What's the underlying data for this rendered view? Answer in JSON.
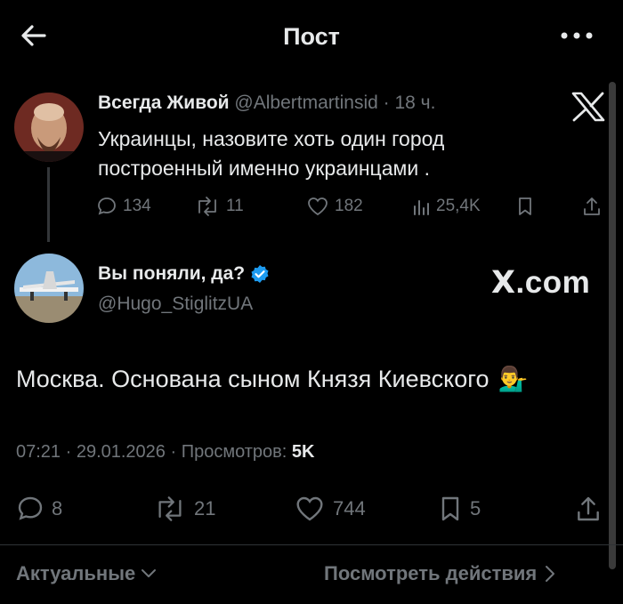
{
  "header": {
    "title": "Пост"
  },
  "parent_tweet": {
    "name": "Всегда Живой",
    "handle": "@Albertmartinsid",
    "time": "· 18 ч.",
    "text_line1": "Украинцы, назовите хоть один город",
    "text_line2": "построенный именно украинцами .",
    "replies": "134",
    "retweets": "11",
    "likes": "182",
    "views": "25,4K"
  },
  "main_tweet": {
    "name": "Вы поняли, да?",
    "handle": "@Hugo_StiglitzUA",
    "text": "Москва. Основана сыном Князя Киевского",
    "emoji": "💁‍♂️",
    "timestamp": "07:21 · 29.01.2026 · Просмотров:",
    "views": "5K",
    "replies": "8",
    "retweets": "21",
    "likes": "744",
    "bookmarks": "5"
  },
  "watermark": {
    "logo_text": "X",
    "domain_text": ".com"
  },
  "footer": {
    "sort_label": "Актуальные",
    "actions_label": "Посмотреть действия"
  },
  "colors": {
    "background": "#000000",
    "text": "#e7e9ea",
    "muted": "#71767b",
    "verified": "#1d9bf0"
  }
}
